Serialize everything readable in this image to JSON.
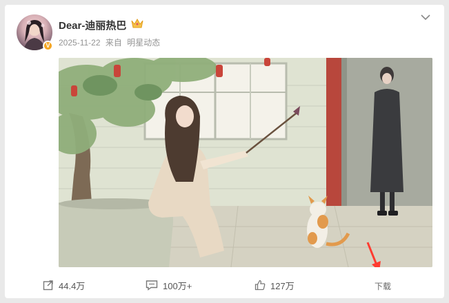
{
  "post": {
    "username": "Dear-迪丽热巴",
    "date": "2025-11-22",
    "source_prefix": "来自",
    "source": "明星动态"
  },
  "actions": {
    "share_count": "44.4万",
    "comment_count": "100万+",
    "like_count": "127万",
    "download_label": "下载"
  },
  "icons": {
    "verified": "verified-badge-icon",
    "crown": "crown-icon",
    "menu": "chevron-down-icon",
    "share": "share-icon",
    "comment": "comment-icon",
    "like": "thumbs-up-icon"
  },
  "colors": {
    "verified_badge": "#f5a623",
    "accent_arrow": "#ff3b30"
  }
}
